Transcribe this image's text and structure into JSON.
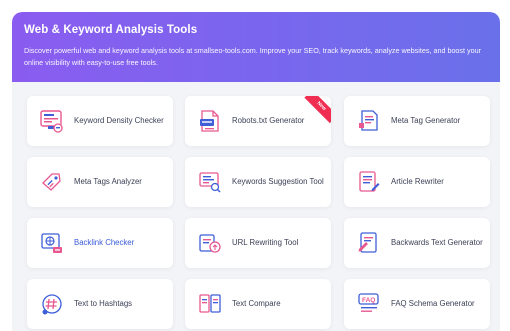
{
  "header": {
    "title": "Web & Keyword Analysis Tools",
    "description": "Discover powerful web and keyword analysis tools at smallseo-tools.com. Improve your SEO, track keywords, analyze websites, and boost your online visibility with easy-to-use free tools."
  },
  "colors": {
    "header_gradient_start": "#8a5cf0",
    "header_gradient_end": "#6a70ea",
    "panel_bg": "#f3f4f7",
    "card_bg": "#ffffff",
    "label_text": "#3b3f55",
    "link_text": "#3a5bd9",
    "ribbon": "#ef2e52",
    "icon_pink": "#e8578f",
    "icon_blue": "#3f5ed8"
  },
  "tools": [
    {
      "label": "Keyword Density Checker",
      "icon": "keyword-density-icon"
    },
    {
      "label": "Robots.txt Generator",
      "icon": "robots-txt-icon",
      "badge": "New"
    },
    {
      "label": "Meta Tag Generator",
      "icon": "meta-tag-icon"
    },
    {
      "label": "Meta Tags Analyzer",
      "icon": "meta-tags-analyzer-icon"
    },
    {
      "label": "Keywords Suggestion Tool",
      "icon": "keywords-suggestion-icon"
    },
    {
      "label": "Article Rewriter",
      "icon": "article-rewriter-icon"
    },
    {
      "label": "Backlink Checker",
      "icon": "backlink-checker-icon"
    },
    {
      "label": "URL Rewriting Tool",
      "icon": "url-rewriting-icon"
    },
    {
      "label": "Backwards Text Generator",
      "icon": "backwards-text-icon"
    },
    {
      "label": "Text to Hashtags",
      "icon": "hashtag-icon"
    },
    {
      "label": "Text Compare",
      "icon": "text-compare-icon"
    },
    {
      "label": "FAQ Schema Generator",
      "icon": "faq-schema-icon"
    }
  ]
}
